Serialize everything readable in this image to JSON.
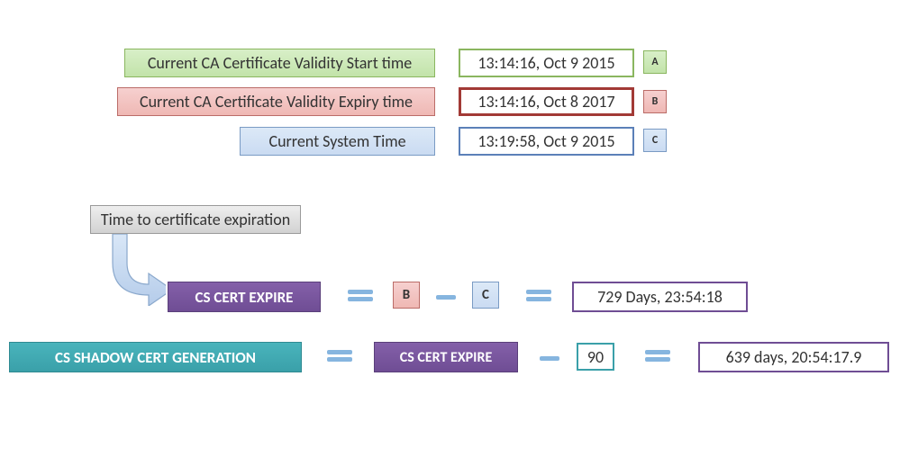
{
  "rows": {
    "start": {
      "label": "Current CA Certificate Validity Start time",
      "value": "13:14:16, Oct 9 2015",
      "tag": "A"
    },
    "expiry": {
      "label": "Current CA Certificate Validity Expiry time",
      "value": "13:14:16, Oct 8 2017",
      "tag": "B"
    },
    "system": {
      "label": "Current System Time",
      "value": "13:19:58, Oct 9 2015",
      "tag": "C"
    }
  },
  "callout": "Time to certificate expiration",
  "eq1": {
    "lhs": "CS CERT EXPIRE",
    "opA": "B",
    "opB": "C",
    "result": "729 Days, 23:54:18"
  },
  "eq2": {
    "lhs": "CS SHADOW CERT GENERATION",
    "mid": "CS CERT EXPIRE",
    "constant": "90",
    "result": "639 days, 20:54:17.9"
  }
}
